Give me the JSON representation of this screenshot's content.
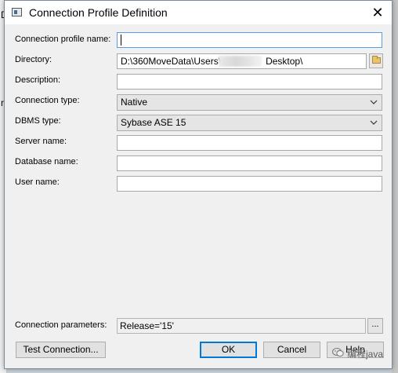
{
  "background": {
    "left_fragment_1": "D",
    "left_fragment_2": "n"
  },
  "window": {
    "title": "Connection Profile Definition",
    "close_glyph": "✕"
  },
  "form": {
    "connection_profile_name": {
      "label": "Connection profile name:",
      "value": ""
    },
    "directory": {
      "label": "Directory:",
      "value_prefix": "D:\\360MoveData\\Users\\",
      "value_suffix": "Desktop\\"
    },
    "description": {
      "label": "Description:",
      "value": ""
    },
    "connection_type": {
      "label": "Connection type:",
      "value": "Native"
    },
    "dbms_type": {
      "label": "DBMS type:",
      "value": "Sybase ASE 15"
    },
    "server_name": {
      "label": "Server name:",
      "value": ""
    },
    "database_name": {
      "label": "Database name:",
      "value": ""
    },
    "user_name": {
      "label": "User name:",
      "value": ""
    },
    "connection_parameters": {
      "label": "Connection parameters:",
      "value": "Release='15'",
      "button": "..."
    }
  },
  "buttons": {
    "test_connection": "Test Connection...",
    "ok": "OK",
    "cancel": "Cancel",
    "help": "Help"
  },
  "watermark": {
    "text": "编程java"
  },
  "colors": {
    "focus_border": "#569de5",
    "default_button": "#0078d7",
    "dialog_bg": "#f0f0f0",
    "folder": "#e9c46a"
  }
}
